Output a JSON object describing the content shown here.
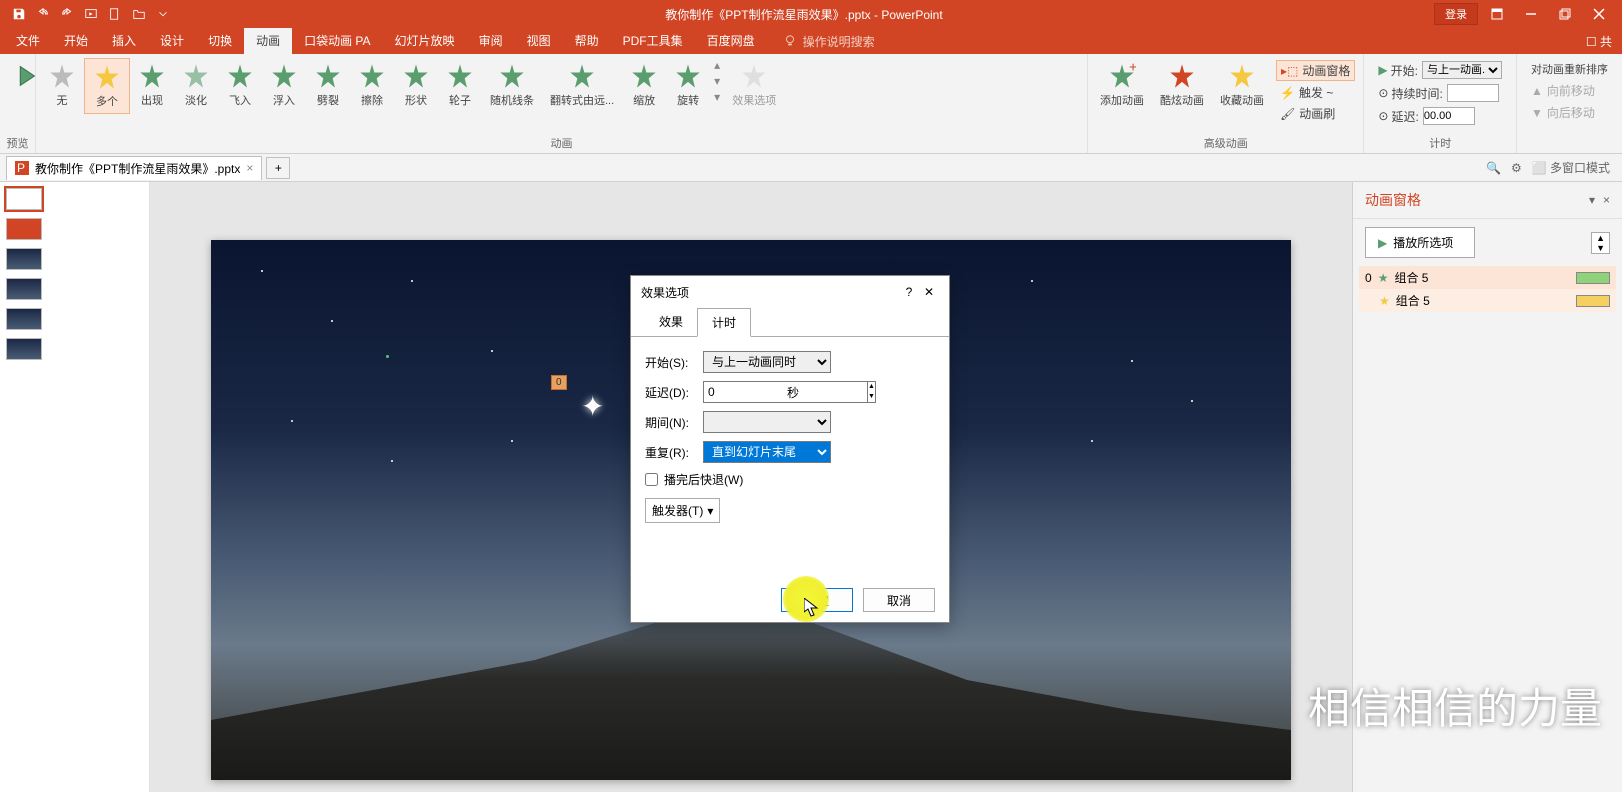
{
  "titlebar": {
    "title": "教你制作《PPT制作流星雨效果》.pptx - PowerPoint",
    "login": "登录"
  },
  "menus": [
    "文件",
    "开始",
    "插入",
    "设计",
    "切换",
    "动画",
    "口袋动画 PA",
    "幻灯片放映",
    "审阅",
    "视图",
    "帮助",
    "PDF工具集",
    "百度网盘"
  ],
  "active_menu_idx": 5,
  "tellme": "操作说明搜索",
  "ribbon": {
    "preview": "预览",
    "anims": [
      "无",
      "多个",
      "出现",
      "淡化",
      "飞入",
      "浮入",
      "劈裂",
      "擦除",
      "形状",
      "轮子",
      "随机线条",
      "翻转式由远...",
      "缩放",
      "旋转"
    ],
    "anim_sel_idx": 1,
    "effect_opts": "效果选项",
    "group_anim": "动画",
    "adv": [
      "添加动画",
      "酷炫动画",
      "收藏动画"
    ],
    "anim_pane_btn": "动画窗格",
    "trigger": "触发 ~",
    "painter": "动画刷",
    "group_adv": "高级动画",
    "start_lbl": "开始:",
    "start_val": "与上一动画...",
    "dur_lbl": "持续时间:",
    "delay_lbl": "延迟:",
    "delay_val": "00.00",
    "group_timing": "计时",
    "reorder": "对动画重新排序",
    "move_fwd": "向前移动",
    "move_bwd": "向后移动"
  },
  "file_tab": "教你制作《PPT制作流星雨效果》.pptx",
  "multi_window": "多窗口模式",
  "anim_pane": {
    "title": "动画窗格",
    "play": "播放所选项",
    "items": [
      {
        "idx": "0",
        "name": "组合 5",
        "color": "#8fd27a"
      },
      {
        "idx": "",
        "name": "组合 5",
        "color": "#f5d060"
      }
    ]
  },
  "dialog": {
    "title": "效果选项",
    "tabs": [
      "效果",
      "计时"
    ],
    "active_tab_idx": 1,
    "rows": {
      "start_lbl": "开始(S):",
      "start_val": "与上一动画同时",
      "delay_lbl": "延迟(D):",
      "delay_val": "0",
      "delay_unit": "秒",
      "period_lbl": "期间(N):",
      "period_val": "",
      "repeat_lbl": "重复(R):",
      "repeat_val": "直到幻灯片末尾",
      "rewind": "播完后快退(W)",
      "trigger": "触发器(T)"
    },
    "ok": "确定",
    "cancel": "取消"
  },
  "marker": "0",
  "watermark": "相信相信的力量"
}
